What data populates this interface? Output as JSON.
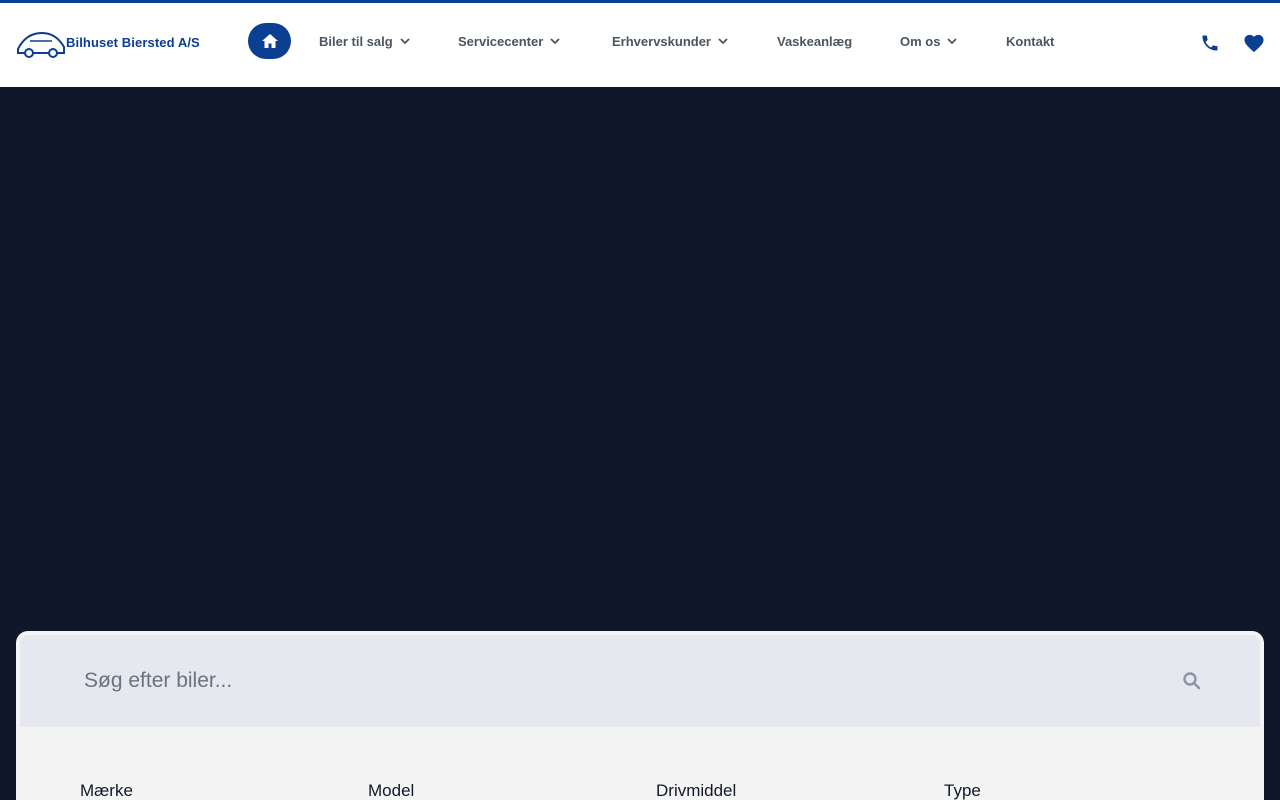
{
  "brand": {
    "name": "Bilhuset Biersted A/S",
    "color": "#0b3f91"
  },
  "nav": {
    "items": [
      {
        "label": "Biler til salg",
        "has_dropdown": true
      },
      {
        "label": "Servicecenter",
        "has_dropdown": true
      },
      {
        "label": "Erhvervskunder",
        "has_dropdown": true
      },
      {
        "label": "Vaskeanlæg",
        "has_dropdown": false
      },
      {
        "label": "Om os",
        "has_dropdown": true
      },
      {
        "label": "Kontakt",
        "has_dropdown": false
      }
    ],
    "icons": [
      "home-icon",
      "phone-icon",
      "heart-icon"
    ]
  },
  "search": {
    "placeholder": "Søg efter biler..."
  },
  "filters": {
    "labels": [
      "Mærke",
      "Model",
      "Drivmiddel",
      "Type"
    ]
  },
  "colors": {
    "hero_bg": "#0f172a",
    "search_bar_bg": "#e5e8ee",
    "card_bg": "#f4f4f5"
  }
}
